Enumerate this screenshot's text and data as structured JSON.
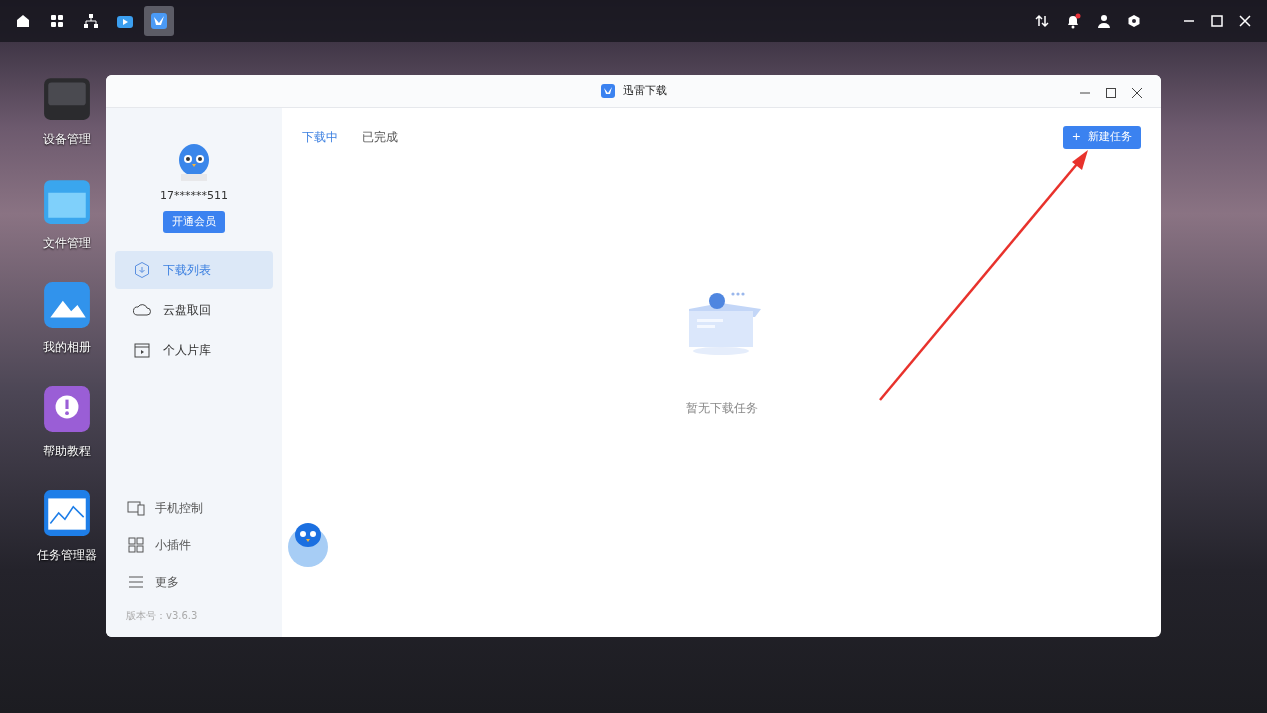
{
  "taskbar": [
    {
      "kind": "home",
      "selected": false
    },
    {
      "kind": "apps",
      "selected": false
    },
    {
      "kind": "network",
      "selected": false
    },
    {
      "kind": "tv",
      "selected": false
    },
    {
      "kind": "bird",
      "selected": true
    }
  ],
  "desktop_icons": [
    {
      "label": "设备管理",
      "kind": "device"
    },
    {
      "label": "文件管理",
      "kind": "folder"
    },
    {
      "label": "我的相册",
      "kind": "photo"
    },
    {
      "label": "帮助教程",
      "kind": "help"
    },
    {
      "label": "任务管理器",
      "kind": "monitor"
    }
  ],
  "window": {
    "title": "迅雷下载"
  },
  "sidebar": {
    "account": "17******511",
    "vip_button": "开通会员",
    "nav": [
      {
        "label": "下载列表",
        "kind": "download",
        "selected": true
      },
      {
        "label": "云盘取回",
        "kind": "cloud",
        "selected": false
      },
      {
        "label": "个人片库",
        "kind": "film",
        "selected": false
      }
    ],
    "tools": [
      {
        "label": "手机控制",
        "kind": "phone"
      },
      {
        "label": "小插件",
        "kind": "widget"
      },
      {
        "label": "更多",
        "kind": "more"
      }
    ],
    "version": "版本号：v3.6.3"
  },
  "tabs": [
    {
      "label": "下载中",
      "selected": true
    },
    {
      "label": "已完成",
      "selected": false
    }
  ],
  "new_task_button": {
    "icon": "+",
    "label": "新建任务"
  },
  "empty_message": "暂无下载任务"
}
